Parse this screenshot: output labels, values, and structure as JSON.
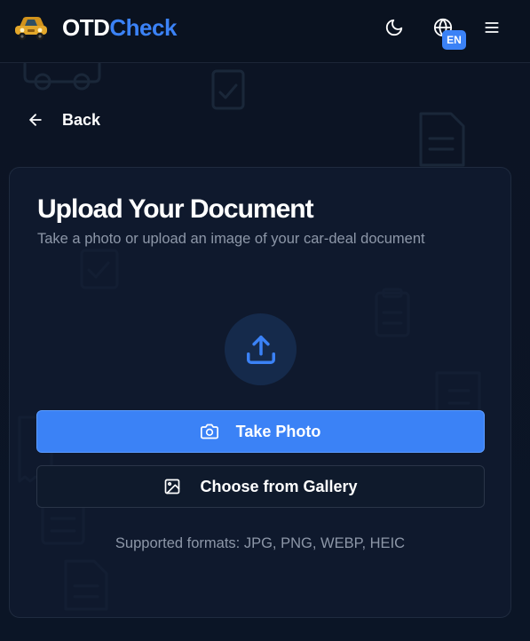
{
  "header": {
    "brand_part1": "OTD",
    "brand_part2": "Check",
    "language": "EN",
    "icons": [
      "car-logo-icon",
      "moon-icon",
      "globe-icon",
      "menu-icon"
    ]
  },
  "nav": {
    "back_label": "Back"
  },
  "upload": {
    "title": "Upload Your Document",
    "subtitle": "Take a photo or upload an image of your car-deal document",
    "take_photo_label": "Take Photo",
    "gallery_label": "Choose from Gallery",
    "formats_text": "Supported formats: JPG, PNG, WEBP, HEIC"
  },
  "colors": {
    "background": "#0b1322",
    "accent": "#3b82f6",
    "muted_text": "#8d97a8",
    "card": "#101c30"
  }
}
